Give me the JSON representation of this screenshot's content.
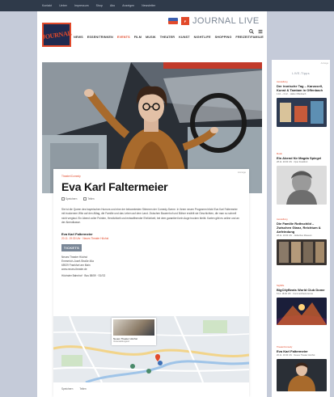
{
  "topbar": {
    "items": [
      "Kontakt",
      "Ueber",
      "Impressum",
      "Shop",
      "Abo",
      "Anzeigen",
      "Newsletter"
    ]
  },
  "header": {
    "logo_text": "JOURNAL",
    "brand_badge": "F",
    "brand_text": "JOURNAL LIVE",
    "nav": [
      "NEWS",
      "ESSEN/TRINKEN",
      "EVENTS",
      "FILM",
      "MUSIK",
      "THEATER",
      "KUNST",
      "NIGHTLIFE",
      "SHOPPING",
      "FREIZEIT/FAMILIE"
    ],
    "nav_active": "EVENTS",
    "icons": [
      "search-icon",
      "menu-icon"
    ]
  },
  "hero": {
    "credit": "Foto: Matthias Vitt"
  },
  "article": {
    "card_small": "Anzeige",
    "kicker": "Theater/Comedy",
    "title": "Eva Karl Faltermeier",
    "actions": [
      "Speichern",
      "Teilen"
    ],
    "body": "Sie ist die Queen des bayerischen Humors und eine der bekanntesten Stimmen der Comedy-Szene. In ihrem neuen Programm blickt Eva Karl Faltermeier mit trockenem Witz auf den Alltag, die Familie und das Leben auf dem Land. Zwischen Bauernhof und Bühne erzählt sie Geschichten, die man so schnell nicht vergisst. Ein Abend voller Pointen, Herzlichkeit und entwaffnender Ehrlichkeit, bei dem garantiert kein Auge trocken bleibt. Karten gibt es online und an der Abendkasse.",
    "event_title": "Eva Karl Faltermeier",
    "event_date": "20.11. 19:30 Uhr · Neues Theater Höchst",
    "tickets_label": "TICKETS",
    "venue_lines": [
      "Neues Theater Höchst",
      "Emmerich-Josef-Straße 46a",
      "65929 Frankfurt am Main",
      "www.neues-theater.de"
    ],
    "transit": "Höchster Bahnhof · Bus 58/59 · S1/S2",
    "map_popup_title": "Neues Theater Höchst",
    "map_popup_sub": "Veranstaltungsort",
    "footer_actions": [
      "Speichern",
      "Teilen"
    ]
  },
  "sidebar": {
    "small": "Anzeige",
    "heading": "LIVE-Tipps",
    "items": [
      {
        "kicker": "Ausstellung",
        "headline": "Der ironische Tag – Karussell, Kunst & Tamtam in Offenbach",
        "detail": "1.10. – 6.12. · Hafen Offenbach"
      },
      {
        "kicker": "Musik",
        "headline": "Ein Abend für Magda Spiegel",
        "detail": "28.11. 20:00 Uhr · Oper Frankfurt"
      },
      {
        "kicker": "Ausstellung",
        "headline": "Die Familie Rothschild – Zwischen Glanz, Reichtum & Anfeindung",
        "detail": "28.11. 10:00 Uhr · Jüdisches Museum"
      },
      {
        "kicker": "Nightlife",
        "headline": "BigCityBeats World Club Dome",
        "detail": "6.12. 18:00 Uhr · Commerzbank-Arena"
      },
      {
        "kicker": "Theater/Comedy",
        "headline": "Eva Karl Faltermeier",
        "detail": "20.11. 19:30 Uhr · Neues Theater Höchst"
      }
    ]
  },
  "colors": {
    "accent": "#e24a2b",
    "navy": "#1f2a4f",
    "page_bg": "#c5cbd9"
  }
}
